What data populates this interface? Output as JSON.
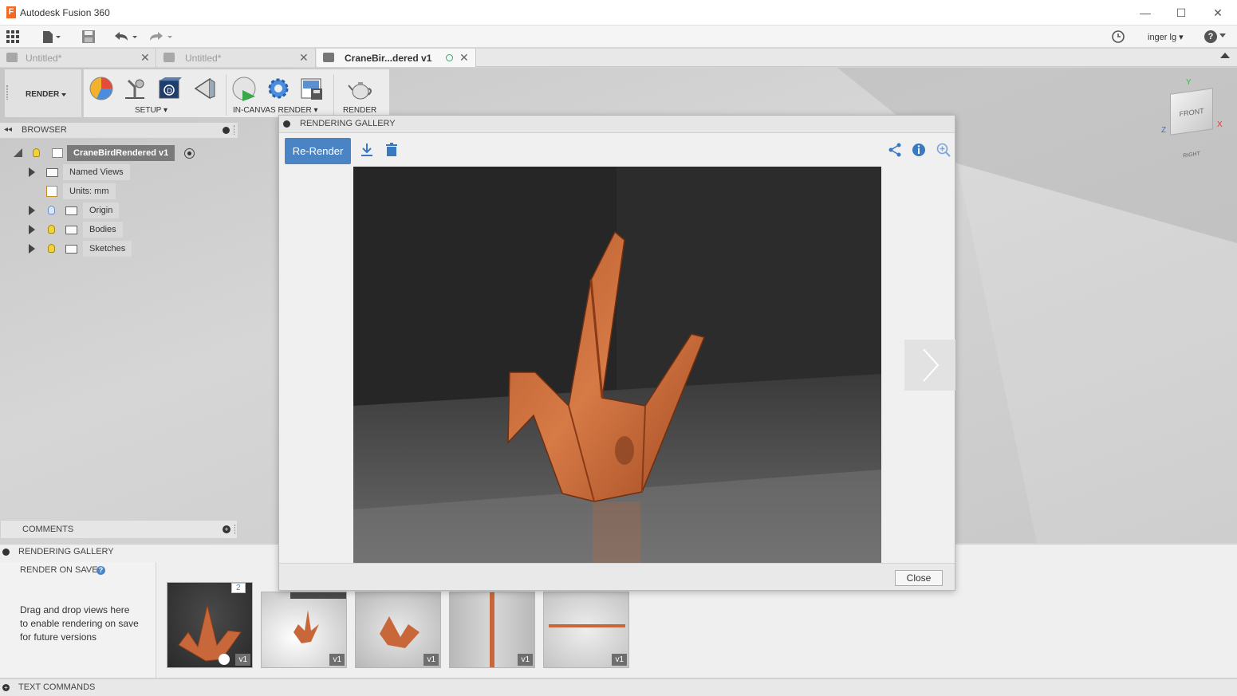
{
  "window": {
    "title": "Autodesk Fusion 360",
    "app_icon_letter": "F",
    "minimize": "—",
    "maximize": "☐",
    "close": "✕"
  },
  "quickbar": {
    "user": "inger lg ▾",
    "help": "?"
  },
  "tabs": [
    {
      "label": "Untitled*"
    },
    {
      "label": "Untitled*"
    },
    {
      "label": "CraneBir...dered v1"
    }
  ],
  "ribbon": {
    "workspace": "RENDER",
    "setup_label": "SETUP",
    "in_canvas_label": "IN-CANVAS RENDER",
    "render_label": "RENDER"
  },
  "browser": {
    "title": "BROWSER",
    "root": "CraneBirdRendered v1",
    "items": [
      {
        "label": "Named Views"
      },
      {
        "label": "Units: mm"
      },
      {
        "label": "Origin"
      },
      {
        "label": "Bodies"
      },
      {
        "label": "Sketches"
      }
    ]
  },
  "comments": {
    "title": "COMMENTS"
  },
  "viewcube": {
    "front_label": "FRONT",
    "right_label": "RIGHT",
    "axis_x": "X",
    "axis_y": "Y",
    "axis_z": "Z"
  },
  "gallery_panel": {
    "title": "RENDERING GALLERY",
    "render_on_save": "RENDER ON SAVE",
    "help_text": "Drag and drop views here to enable rendering on save for future versions",
    "thumbnails": [
      {
        "version": "v1",
        "count_badge": "2"
      },
      {
        "version": "v1"
      },
      {
        "version": "v1"
      },
      {
        "version": "v1"
      },
      {
        "version": "v1"
      }
    ]
  },
  "text_commands": {
    "title": "TEXT COMMANDS"
  },
  "dialog": {
    "title": "RENDERING GALLERY",
    "rerender_label": "Re-Render",
    "close_label": "Close"
  },
  "colors": {
    "accent": "#4a84c5",
    "wood": "#c8683a",
    "bulb_on": "#f2d13a",
    "bulb_off": "#8db3e2"
  }
}
